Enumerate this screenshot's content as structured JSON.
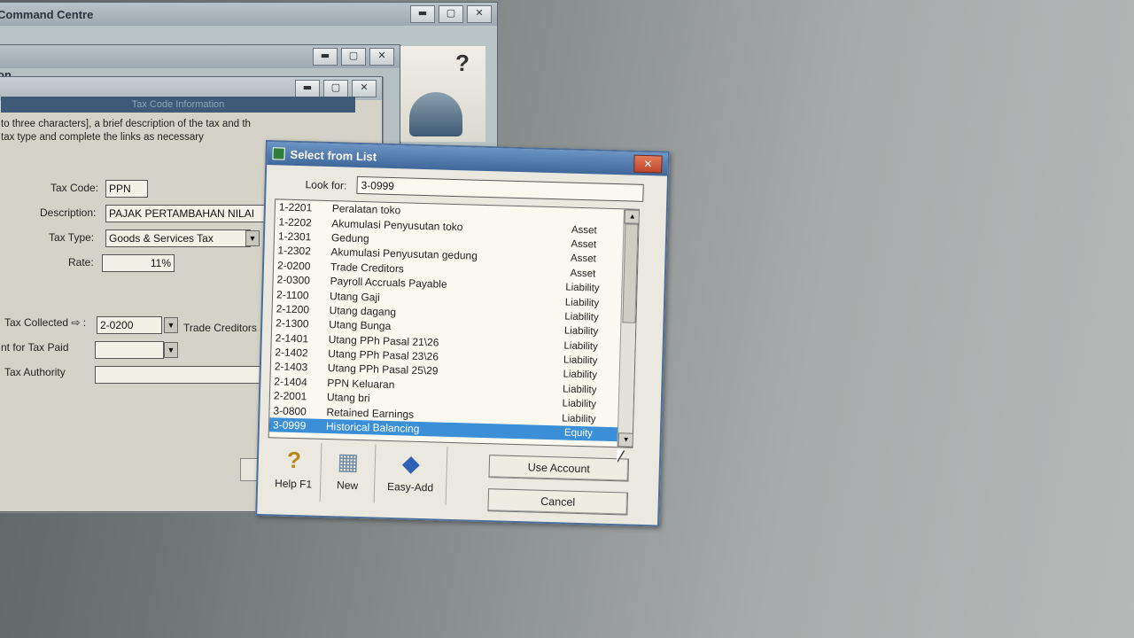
{
  "command_centre": {
    "title": "Command Centre"
  },
  "second_window": {
    "title": "on"
  },
  "tax_code_info": {
    "banner": "Tax Code Information",
    "instruction_line1": "to three characters], a brief description of the tax and th",
    "instruction_line2": "tax type and complete the links as necessary",
    "tax_code_label": "Tax Code:",
    "tax_code_value": "PPN",
    "description_label": "Description:",
    "description_value": "PAJAK PERTAMBAHAN NILAI",
    "tax_type_label": "Tax Type:",
    "tax_type_value": "Goods & Services Tax",
    "rate_label": "Rate:",
    "rate_value": "11%",
    "collected_label": "Tax Collected ⇨ :",
    "collected_value": "2-0200",
    "collected_name": "Trade Creditors",
    "paid_label": "nt for Tax Paid",
    "authority_label": "Tax Authority"
  },
  "select_dialog": {
    "title": "Select from List",
    "look_for_label": "Look for:",
    "look_for_value": "3-0999",
    "rows": [
      {
        "code": "1-2201",
        "name": "Peralatan toko",
        "type": ""
      },
      {
        "code": "1-2202",
        "name": "Akumulasi Penyusutan toko",
        "type": "Asset"
      },
      {
        "code": "1-2301",
        "name": "Gedung",
        "type": "Asset"
      },
      {
        "code": "1-2302",
        "name": "Akumulasi Penyusutan gedung",
        "type": "Asset"
      },
      {
        "code": "2-0200",
        "name": "Trade Creditors",
        "type": "Asset"
      },
      {
        "code": "2-0300",
        "name": "Payroll Accruals Payable",
        "type": "Liability"
      },
      {
        "code": "2-1100",
        "name": "Utang Gaji",
        "type": "Liability"
      },
      {
        "code": "2-1200",
        "name": "Utang dagang",
        "type": "Liability"
      },
      {
        "code": "2-1300",
        "name": "Utang Bunga",
        "type": "Liability"
      },
      {
        "code": "2-1401",
        "name": "Utang PPh Pasal 21\\26",
        "type": "Liability"
      },
      {
        "code": "2-1402",
        "name": "Utang PPh Pasal 23\\26",
        "type": "Liability"
      },
      {
        "code": "2-1403",
        "name": "Utang PPh Pasal 25\\29",
        "type": "Liability"
      },
      {
        "code": "2-1404",
        "name": "PPN Keluaran",
        "type": "Liability"
      },
      {
        "code": "2-2001",
        "name": "Utang bri",
        "type": "Liability"
      },
      {
        "code": "3-0800",
        "name": "Retained Earnings",
        "type": "Liability"
      },
      {
        "code": "3-0999",
        "name": "Historical Balancing",
        "type": "Equity"
      }
    ],
    "last_type": "Equity",
    "help_label": "Help F1",
    "new_label": "New",
    "easy_add_label": "Easy-Add",
    "use_account_label": "Use Account",
    "cancel_label": "Cancel"
  }
}
